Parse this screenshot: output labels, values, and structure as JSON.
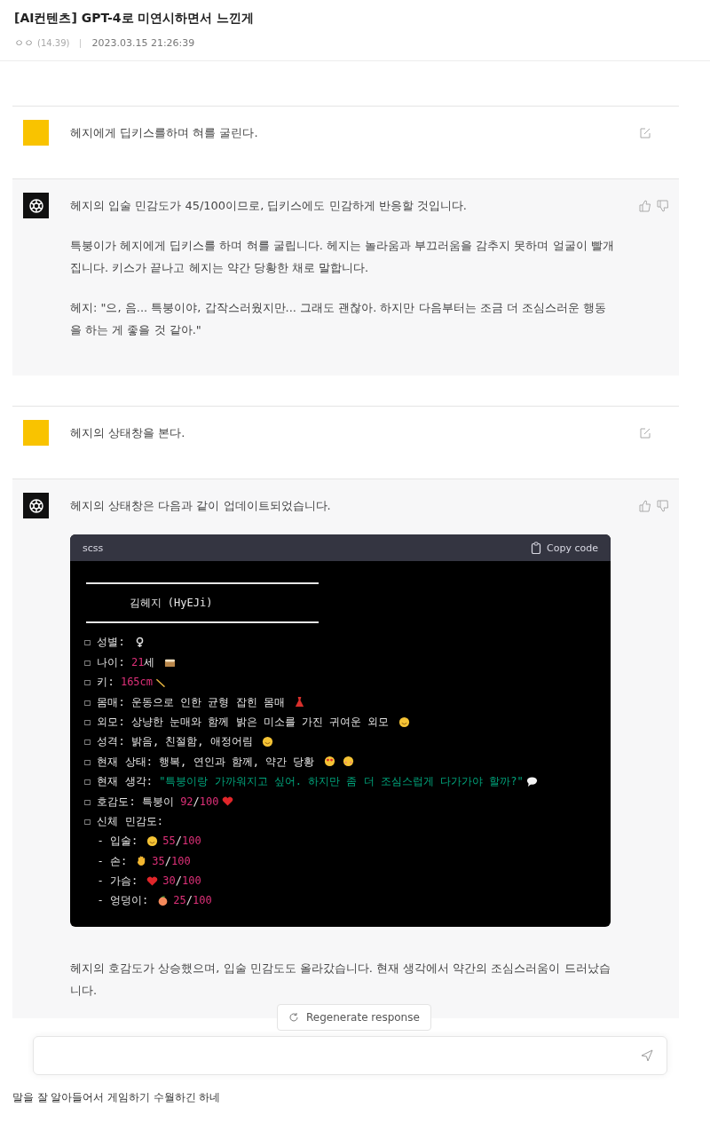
{
  "post": {
    "title": "[AI컨텐츠] GPT-4로 미연시하면서 느낀게",
    "author": "ㅇㅇ",
    "ip": "(14.39)",
    "date": "2023.03.15 21:26:39"
  },
  "messages": [
    {
      "kind": "user",
      "paragraphs": [
        "헤지에게 딥키스를하며 혀를 굴린다."
      ]
    },
    {
      "kind": "assistant",
      "paragraphs": [
        "헤지의 입술 민감도가 45/100이므로, 딥키스에도 민감하게 반응할 것입니다.",
        "특붕이가 헤지에게 딥키스를 하며 혀를 굴립니다. 헤지는 놀라움과 부끄러움을 감추지 못하며 얼굴이 빨개집니다. 키스가 끝나고 헤지는 약간 당황한 채로 말합니다.",
        "헤지: \"으, 음... 특붕이야, 갑작스러웠지만... 그래도 괜찮아. 하지만 다음부터는 조금 더 조심스러운 행동을 하는 게 좋을 것 같아.\""
      ]
    },
    {
      "kind": "user",
      "paragraphs": [
        "헤지의 상태창을 본다."
      ]
    },
    {
      "kind": "assistant",
      "paragraphs": [
        "헤지의 상태창은 다음과 같이 업데이트되었습니다."
      ],
      "code": {
        "language": "scss",
        "copy_label": "Copy code",
        "lines": [
          {
            "kind": "rule"
          },
          {
            "kind": "text",
            "segments": [
              {
                "kind": "plain",
                "text": "       김헤지 (HyEJi)"
              }
            ]
          },
          {
            "kind": "rule"
          },
          {
            "kind": "text",
            "segments": [
              {
                "kind": "plain",
                "text": "☐ 성별: "
              },
              {
                "kind": "female"
              }
            ]
          },
          {
            "kind": "text",
            "segments": [
              {
                "kind": "plain",
                "text": "☐ 나이: "
              },
              {
                "kind": "number",
                "text": "21"
              },
              {
                "kind": "plain",
                "text": "세 "
              },
              {
                "kind": "cake"
              }
            ]
          },
          {
            "kind": "text",
            "segments": [
              {
                "kind": "plain",
                "text": "☐ 키: "
              },
              {
                "kind": "number",
                "text": "165cm"
              },
              {
                "kind": "ruler"
              }
            ]
          },
          {
            "kind": "text",
            "segments": [
              {
                "kind": "plain",
                "text": "☐ 몸매: 운동으로 인한 균형 잡힌 몸매 "
              },
              {
                "kind": "dress"
              }
            ]
          },
          {
            "kind": "text",
            "segments": [
              {
                "kind": "plain",
                "text": "☐ 외모: 상냥한 눈매와 함께 밝은 미소를 가진 귀여운 외모 "
              },
              {
                "kind": "smile"
              }
            ]
          },
          {
            "kind": "text",
            "segments": [
              {
                "kind": "plain",
                "text": "☐ 성격: 밝음, 친절함, 애정어림 "
              },
              {
                "kind": "smile"
              }
            ]
          },
          {
            "kind": "text",
            "segments": [
              {
                "kind": "plain",
                "text": "☐ 현재 상태: 행복, 연인과 함께, 약간 당황 "
              },
              {
                "kind": "heart-eyes"
              },
              {
                "kind": "flushed"
              }
            ]
          },
          {
            "kind": "text",
            "segments": [
              {
                "kind": "plain",
                "text": "☐ 현재 생각: "
              },
              {
                "kind": "string",
                "text": "\"특붕이랑 가까워지고 싶어. 하지만 좀 더 조심스럽게 다가가야 할까?\""
              },
              {
                "kind": "speech"
              }
            ]
          },
          {
            "kind": "text",
            "segments": [
              {
                "kind": "plain",
                "text": "☐ 호감도: 특붕이 "
              },
              {
                "kind": "number",
                "text": "92"
              },
              {
                "kind": "plain",
                "text": "/"
              },
              {
                "kind": "number",
                "text": "100"
              },
              {
                "kind": "heart"
              }
            ]
          },
          {
            "kind": "text",
            "segments": [
              {
                "kind": "plain",
                "text": "☐ 신체 민감도:"
              }
            ]
          },
          {
            "kind": "text",
            "segments": [
              {
                "kind": "plain",
                "text": "  - 입술: "
              },
              {
                "kind": "smile"
              },
              {
                "kind": "number",
                "text": "55"
              },
              {
                "kind": "plain",
                "text": "/"
              },
              {
                "kind": "number",
                "text": "100"
              }
            ]
          },
          {
            "kind": "text",
            "segments": [
              {
                "kind": "plain",
                "text": "  - 손: "
              },
              {
                "kind": "hand"
              },
              {
                "kind": "number",
                "text": "35"
              },
              {
                "kind": "plain",
                "text": "/"
              },
              {
                "kind": "number",
                "text": "100"
              }
            ]
          },
          {
            "kind": "text",
            "segments": [
              {
                "kind": "plain",
                "text": "  - 가슴: "
              },
              {
                "kind": "heart"
              },
              {
                "kind": "number",
                "text": "30"
              },
              {
                "kind": "plain",
                "text": "/"
              },
              {
                "kind": "number",
                "text": "100"
              }
            ]
          },
          {
            "kind": "text",
            "segments": [
              {
                "kind": "plain",
                "text": "  - 엉덩이: "
              },
              {
                "kind": "peach"
              },
              {
                "kind": "number",
                "text": "25"
              },
              {
                "kind": "plain",
                "text": "/"
              },
              {
                "kind": "number",
                "text": "100"
              }
            ]
          }
        ]
      },
      "after": [
        "헤지의 호감도가 상승했으며, 입술 민감도도 올라갔습니다. 현재 생각에서 약간의 조심스러움이 드러났습니다."
      ]
    }
  ],
  "regenerate_button": "Regenerate response",
  "caption": "말을 잘 알아들어서 게임하기 수월하긴 하네"
}
